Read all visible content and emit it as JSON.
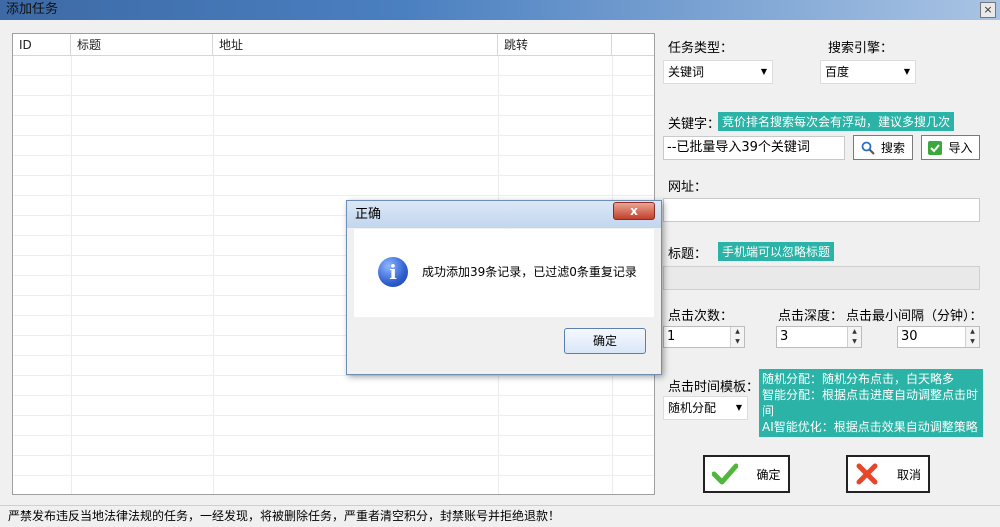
{
  "window": {
    "title": "添加任务",
    "close_symbol": "×"
  },
  "grid": {
    "columns": [
      "ID",
      "标题",
      "地址",
      "跳转"
    ],
    "rows": []
  },
  "panel": {
    "task_type_label": "任务类型：",
    "task_type_value": "关键词",
    "engine_label": "搜索引擎：",
    "engine_value": "百度",
    "keyword_label": "关键字：",
    "keyword_tip": "竞价排名搜索每次会有浮动，建议多搜几次",
    "keyword_value": "--已批量导入39个关键词",
    "search_button": "搜索",
    "import_button": "导入",
    "url_label": "网址：",
    "url_value": "",
    "title_label": "标题：",
    "title_tip": "手机端可以忽略标题",
    "title_value": "",
    "clicks_label": "点击次数：",
    "clicks_value": "1",
    "depth_label": "点击深度：",
    "depth_value": "3",
    "interval_label": "点击最小间隔（分钟）：",
    "interval_value": "30",
    "template_label": "点击时间模板：",
    "template_value": "随机分配",
    "template_tips": [
      "随机分配：随机分布点击，白天略多",
      "智能分配：根据点击进度自动调整点击时间",
      "AI智能优化：根据点击效果自动调整策略"
    ],
    "confirm_button": "确定",
    "cancel_button": "取消"
  },
  "status": "严禁发布违反当地法律法规的任务，一经发现，将被删除任务，严重者清空积分，封禁账号并拒绝退款！",
  "dialog": {
    "title": "正确",
    "close_symbol": "x",
    "message": "成功添加39条记录，已过滤0条重复记录",
    "ok_button": "确定"
  },
  "colors": {
    "tip_bg": "#2ab3a6",
    "title_bar": "#4a7fc0"
  }
}
